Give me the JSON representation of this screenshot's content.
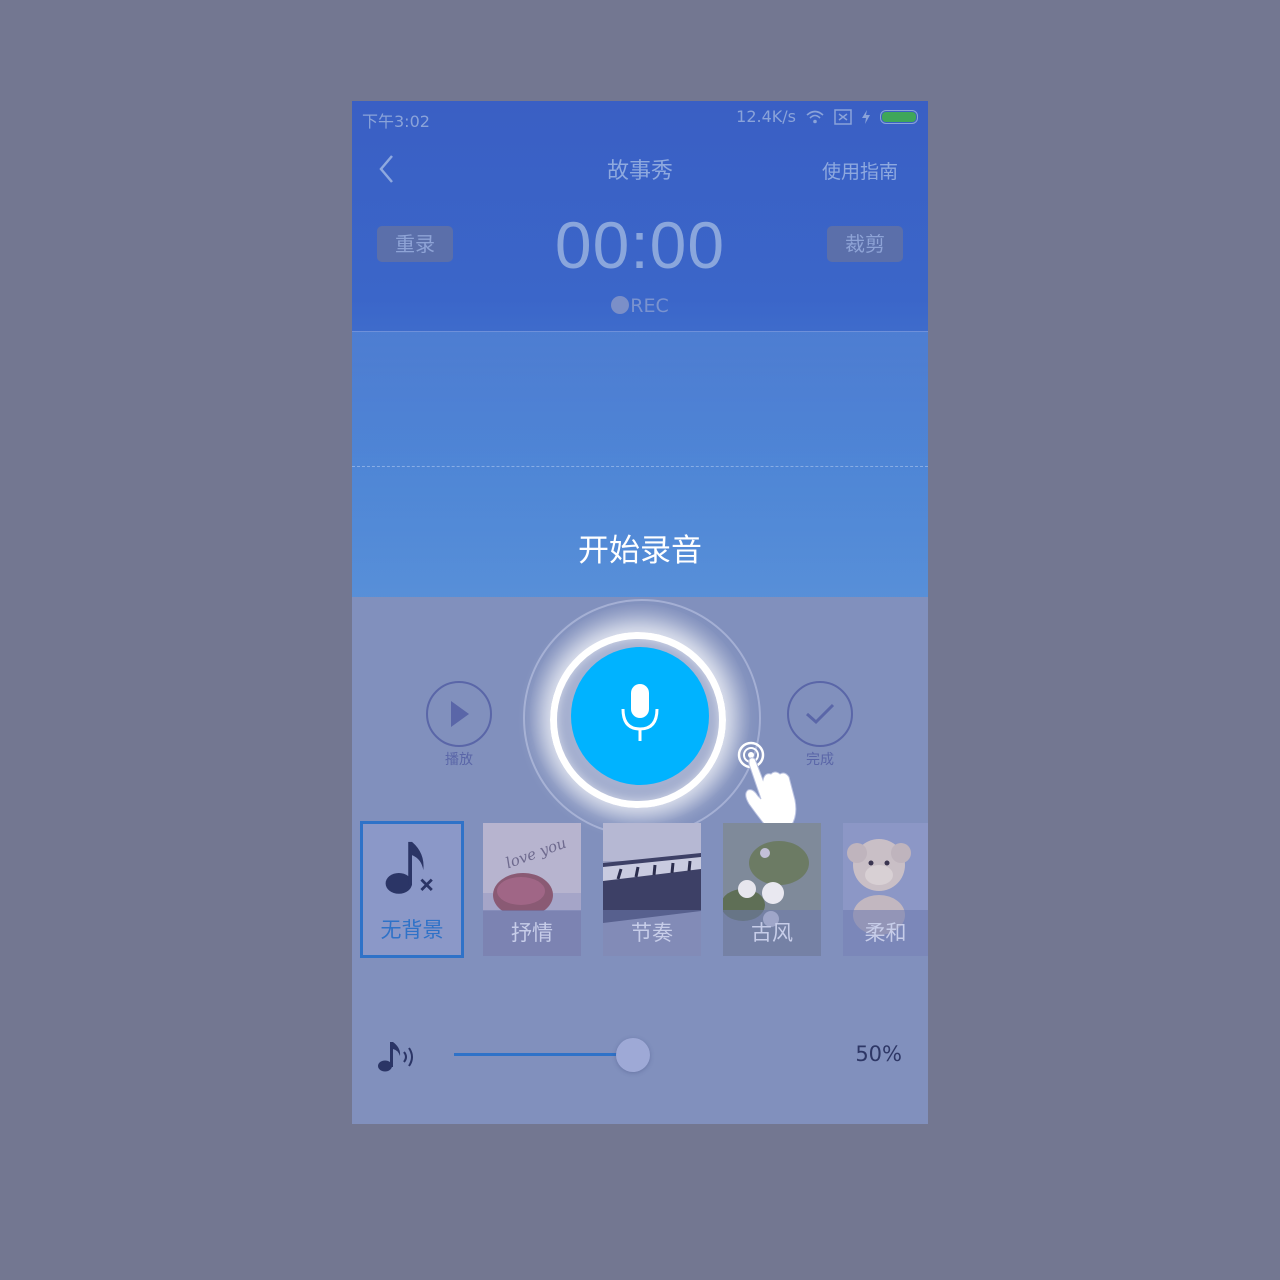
{
  "status_bar": {
    "time": "下午3:02",
    "network_speed": "12.4K/s",
    "icons": [
      "wifi-icon",
      "sim-icon",
      "bolt-icon",
      "battery-icon"
    ],
    "battery_color": "#3fa659"
  },
  "nav": {
    "back_icon": "chevron-left-icon",
    "title": "故事秀",
    "guide_label": "使用指南"
  },
  "recorder": {
    "rerecord_label": "重录",
    "trim_label": "裁剪",
    "timer": "00:00",
    "rec_label": "REC",
    "start_label": "开始录音",
    "record_button_icon": "microphone-icon",
    "record_button_color": "#00b3ff"
  },
  "controls": {
    "play_label": "播放",
    "done_label": "完成"
  },
  "music": {
    "items": [
      {
        "label": "无背景",
        "icon": "music-note-off-icon",
        "selected": true
      },
      {
        "label": "抒情",
        "icon": "image-thumbnail",
        "selected": false
      },
      {
        "label": "节奏",
        "icon": "image-thumbnail",
        "selected": false
      },
      {
        "label": "古风",
        "icon": "image-thumbnail",
        "selected": false
      },
      {
        "label": "柔和",
        "icon": "image-thumbnail",
        "selected": false
      }
    ]
  },
  "volume": {
    "icon": "volume-icon",
    "value": "50%",
    "level": 0.5
  },
  "colors": {
    "accent": "#2f72c8",
    "overlay": "#737791"
  }
}
